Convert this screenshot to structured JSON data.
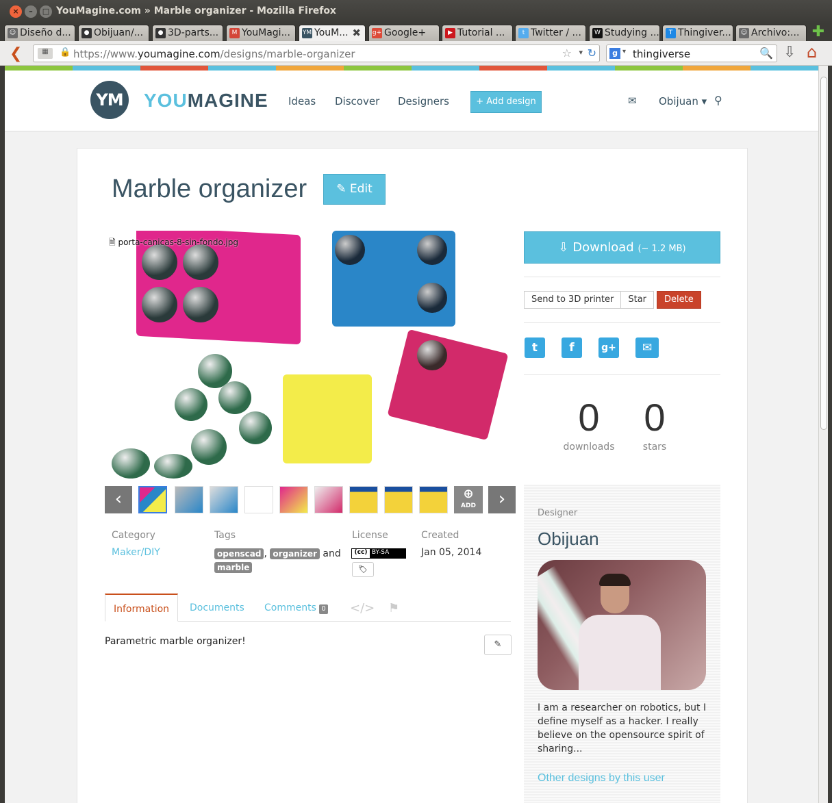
{
  "window": {
    "title": "YouMagine.com » Marble organizer - Mozilla Firefox",
    "controls": [
      "×",
      "–",
      "□"
    ]
  },
  "tabs": [
    {
      "label": "Diseño d...",
      "icon": "person-icon",
      "color": "#6a6a6a"
    },
    {
      "label": "Obijuan/...",
      "icon": "github-icon",
      "color": "#333333"
    },
    {
      "label": "3D-parts...",
      "icon": "github-icon",
      "color": "#333333"
    },
    {
      "label": "YouMagi...",
      "icon": "gmail-icon",
      "color": "#d44638"
    },
    {
      "label": "YouM...",
      "icon": "youmagine-icon",
      "color": "#3a5463",
      "active": true
    },
    {
      "label": "Google+",
      "icon": "googleplus-icon",
      "color": "#dd4b39"
    },
    {
      "label": "Tutorial ...",
      "icon": "youtube-icon",
      "color": "#cc181e"
    },
    {
      "label": "Twitter / ...",
      "icon": "twitter-icon",
      "color": "#55acee"
    },
    {
      "label": "Studying ...",
      "icon": "wikipedia-icon",
      "color": "#111111"
    },
    {
      "label": "Thingiver...",
      "icon": "thingiverse-icon",
      "color": "#1e88e5"
    },
    {
      "label": "Archivo:...",
      "icon": "person-icon",
      "color": "#6a6a6a"
    }
  ],
  "navbar": {
    "url_prefix": "https://www.",
    "url_domain": "youmagine.com",
    "url_path": "/designs/marble-organizer",
    "search_value": "thingiverse",
    "search_engine_glyph": "g"
  },
  "colorstripe": [
    "#8dc63f",
    "#5bc0de",
    "#e1563b",
    "#5bc0de",
    "#f0a63c",
    "#8dc63f",
    "#5bc0de",
    "#e1563b",
    "#5bc0de",
    "#8dc63f",
    "#f0a63c",
    "#5bc0de"
  ],
  "site": {
    "logo_initials": "YM",
    "logo_you": "YOU",
    "logo_magine": "MAGINE",
    "nav": [
      "Ideas",
      "Discover",
      "Designers"
    ],
    "add_design": "+ Add design",
    "user": "Obijuan ▾"
  },
  "design": {
    "title": "Marble organizer",
    "edit_label": "✎ Edit",
    "image_caption": "porta-canicas-8-sin-fondo.jpg",
    "gallery_add_label": "ADD",
    "meta": {
      "category_label": "Category",
      "category": "Maker/DIY",
      "tags_label": "Tags",
      "tags": [
        "openscad",
        "organizer",
        "marble"
      ],
      "tags_join": ",",
      "tags_and": "and",
      "license_label": "License",
      "license_cc": "(cc)",
      "license_type": "BY-SA",
      "created_label": "Created",
      "created": "Jan 05, 2014"
    },
    "tabs": {
      "information": "Information",
      "documents": "Documents",
      "comments": "Comments",
      "comments_count": "0"
    },
    "description": "Parametric marble organizer!"
  },
  "sidebar": {
    "download_label": "Download",
    "download_size": "(~ 1.2 MB)",
    "send_printer": "Send to 3D printer",
    "star": "Star",
    "delete": "Delete",
    "downloads_count": "0",
    "downloads_label": "downloads",
    "stars_count": "0",
    "stars_label": "stars",
    "designer_label": "Designer",
    "designer_name": "Obijuan",
    "designer_bio": "I am a researcher on robotics, but I define myself as a hacker. I really believe on the opensource spirit of sharing...",
    "other_designs": "Other designs by this user"
  }
}
